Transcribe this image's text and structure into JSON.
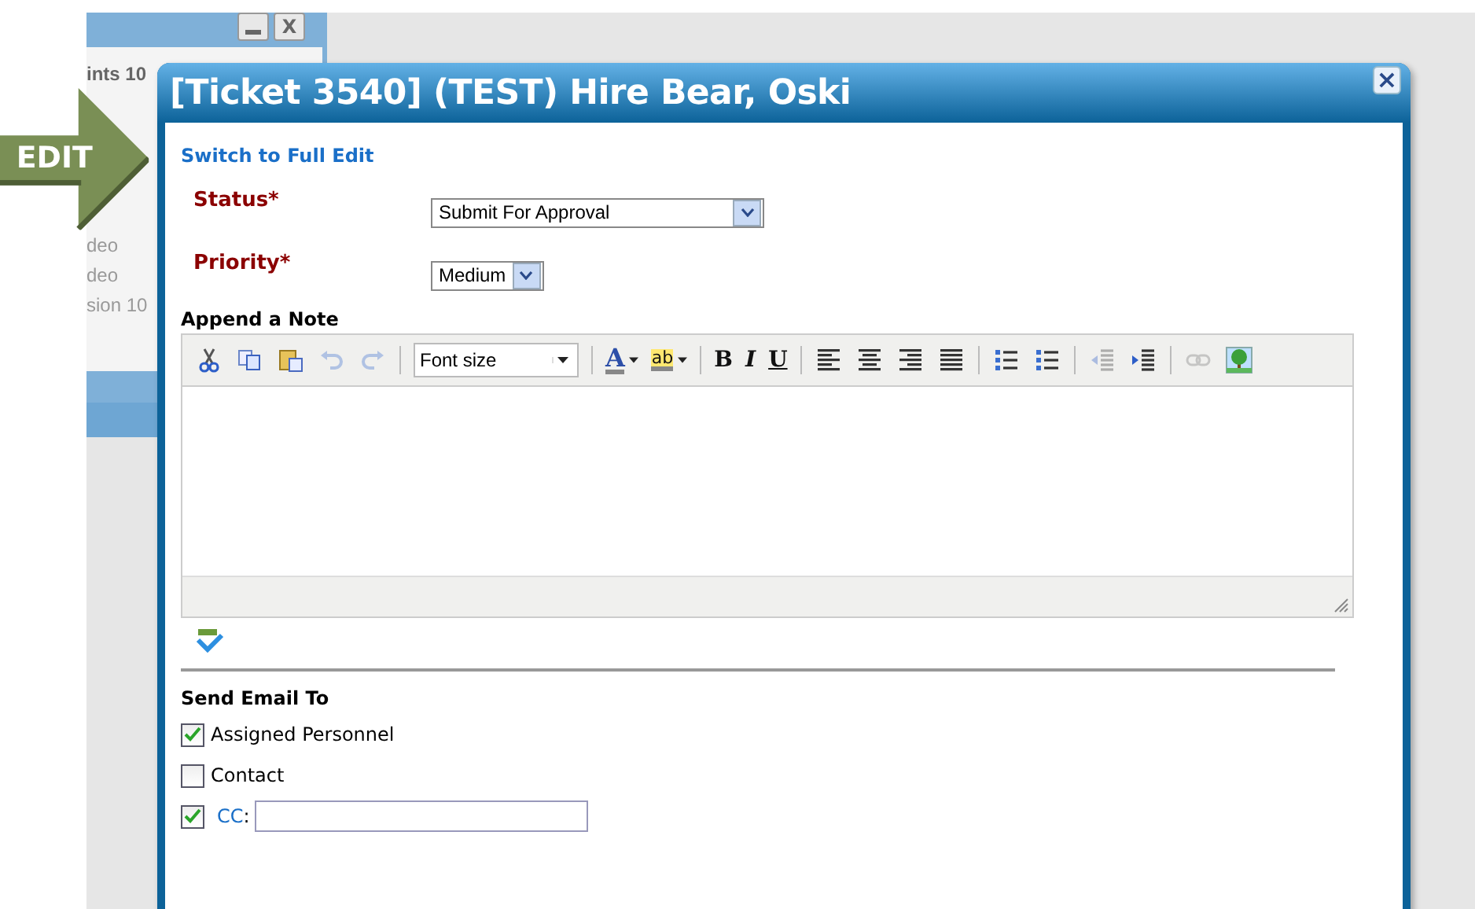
{
  "background_window": {
    "close_label": "X",
    "lines": [
      "ints 10",
      "deo",
      "deo",
      "sion 10"
    ]
  },
  "annotation": {
    "label": "EDIT"
  },
  "dialog": {
    "title": "[Ticket 3540] (TEST) Hire Bear, Oski",
    "close_label": "×",
    "full_edit_link": "Switch to Full Edit"
  },
  "fields": [
    {
      "label": "Status*",
      "value": "Submit For Approval",
      "kind": "wide"
    },
    {
      "label": "Priority*",
      "value": "Medium",
      "kind": "narrow"
    }
  ],
  "note": {
    "label": "Append a Note",
    "toolbar": [
      {
        "kind": "cut",
        "disabled": false
      },
      {
        "kind": "copy",
        "disabled": false
      },
      {
        "kind": "paste",
        "disabled": false
      },
      {
        "kind": "undo",
        "disabled": true
      },
      {
        "kind": "redo",
        "disabled": true
      },
      {
        "kind": "sep"
      },
      {
        "kind": "select",
        "text": "Font size"
      },
      {
        "kind": "sep"
      },
      {
        "kind": "forecolor",
        "text": "A"
      },
      {
        "kind": "backcolor",
        "text": "ab"
      },
      {
        "kind": "sep"
      },
      {
        "kind": "bold",
        "text": "B"
      },
      {
        "kind": "italic",
        "text": "I"
      },
      {
        "kind": "underline",
        "text": "U"
      },
      {
        "kind": "sep"
      },
      {
        "kind": "align-left",
        "disabled": false
      },
      {
        "kind": "align-center",
        "disabled": false
      },
      {
        "kind": "align-right",
        "disabled": false
      },
      {
        "kind": "justify",
        "disabled": false
      },
      {
        "kind": "sep"
      },
      {
        "kind": "bullets",
        "disabled": false
      },
      {
        "kind": "numbers",
        "disabled": false
      },
      {
        "kind": "sep"
      },
      {
        "kind": "outdent",
        "disabled": true
      },
      {
        "kind": "indent",
        "disabled": false
      },
      {
        "kind": "sep"
      },
      {
        "kind": "link",
        "disabled": true
      },
      {
        "kind": "image",
        "disabled": false
      }
    ]
  },
  "email": {
    "label": "Send Email To",
    "options": [
      {
        "label": "Assigned Personnel",
        "checked": true,
        "kind": "plain"
      },
      {
        "label": "Contact",
        "checked": false,
        "kind": "plain"
      },
      {
        "label": "CC",
        "suffix": ":",
        "checked": true,
        "kind": "field"
      }
    ]
  }
}
